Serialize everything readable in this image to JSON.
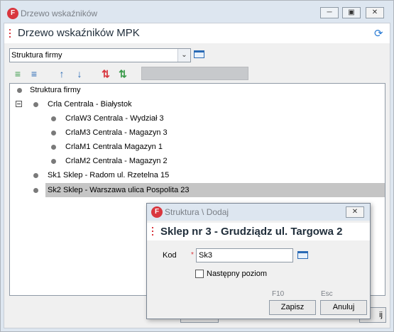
{
  "window": {
    "title": "Drzewo wskaźników",
    "app_icon": "F",
    "controls": [
      "minimize-icon",
      "restore-icon",
      "close-icon"
    ]
  },
  "header": {
    "title": "Drzewo wskaźników MPK",
    "refresh_icon": "refresh-icon"
  },
  "structure_select": {
    "value": "Struktura firmy"
  },
  "toolbar": {
    "buttons": [
      "add-child-icon",
      "add-sibling-icon",
      "move-up-icon",
      "move-down-icon",
      "import-icon",
      "export-icon"
    ]
  },
  "tree": {
    "root": "Struktura firmy",
    "nodes": [
      {
        "label": "Crla Centrala - Białystok",
        "expanded": true
      },
      {
        "label": "CrlaW3 Centrala - Wydział 3"
      },
      {
        "label": "CrlaM3 Centrala - Magazyn 3"
      },
      {
        "label": "CrlaM1 Centrala Magazyn 1"
      },
      {
        "label": "CrlaM2 Centrala - Magazyn 2"
      },
      {
        "label": "Sk1 Sklep - Radom ul. Rzetelna 15"
      },
      {
        "label": "Sk2 Sklep - Warszawa ulica Pospolita 23",
        "selected": true
      }
    ]
  },
  "main_buttons": {
    "cancel_partial": "ij"
  },
  "dialog": {
    "title": "Struktura \\ Dodaj",
    "header_title": "Sklep nr 3 - Grudziądz ul. Targowa 2",
    "kod_label": "Kod",
    "required_mark": "*",
    "kod_value": "Sk3",
    "next_level_label": "Następny poziom",
    "next_level_checked": false,
    "save_hint": "F10",
    "cancel_hint": "Esc",
    "save_label": "Zapisz",
    "cancel_label": "Anuluj"
  }
}
